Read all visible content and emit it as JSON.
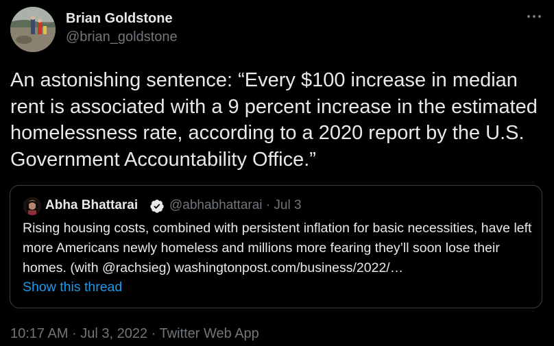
{
  "author": {
    "name": "Brian Goldstone",
    "handle": "@brian_goldstone"
  },
  "tweet": {
    "text": "An astonishing sentence: “Every $100 increase in median rent is associated with a 9 percent increase in the estimated homelessness rate, according to a 2020 report by the U.S. Government Accountability Office.”"
  },
  "quoted": {
    "name": "Abha Bhattarai",
    "verified": true,
    "handle_date": "@abhabhattarai · Jul 3",
    "text": "Rising housing costs, combined with persistent inflation for basic necessities, have left more Americans newly homeless and millions more fearing they’ll soon lose their homes. (with @rachsieg) washingtonpost.com/business/2022/…",
    "show_thread": "Show this thread"
  },
  "meta": {
    "timestamp": "10:17 AM · Jul 3, 2022 · Twitter Web App"
  },
  "colors": {
    "background": "#000000",
    "text": "#e7e9ea",
    "secondary": "#71767b",
    "link": "#1d9bf0",
    "border": "#3e4144"
  },
  "icons": {
    "more": "more-icon",
    "verified": "verified-badge-icon"
  }
}
